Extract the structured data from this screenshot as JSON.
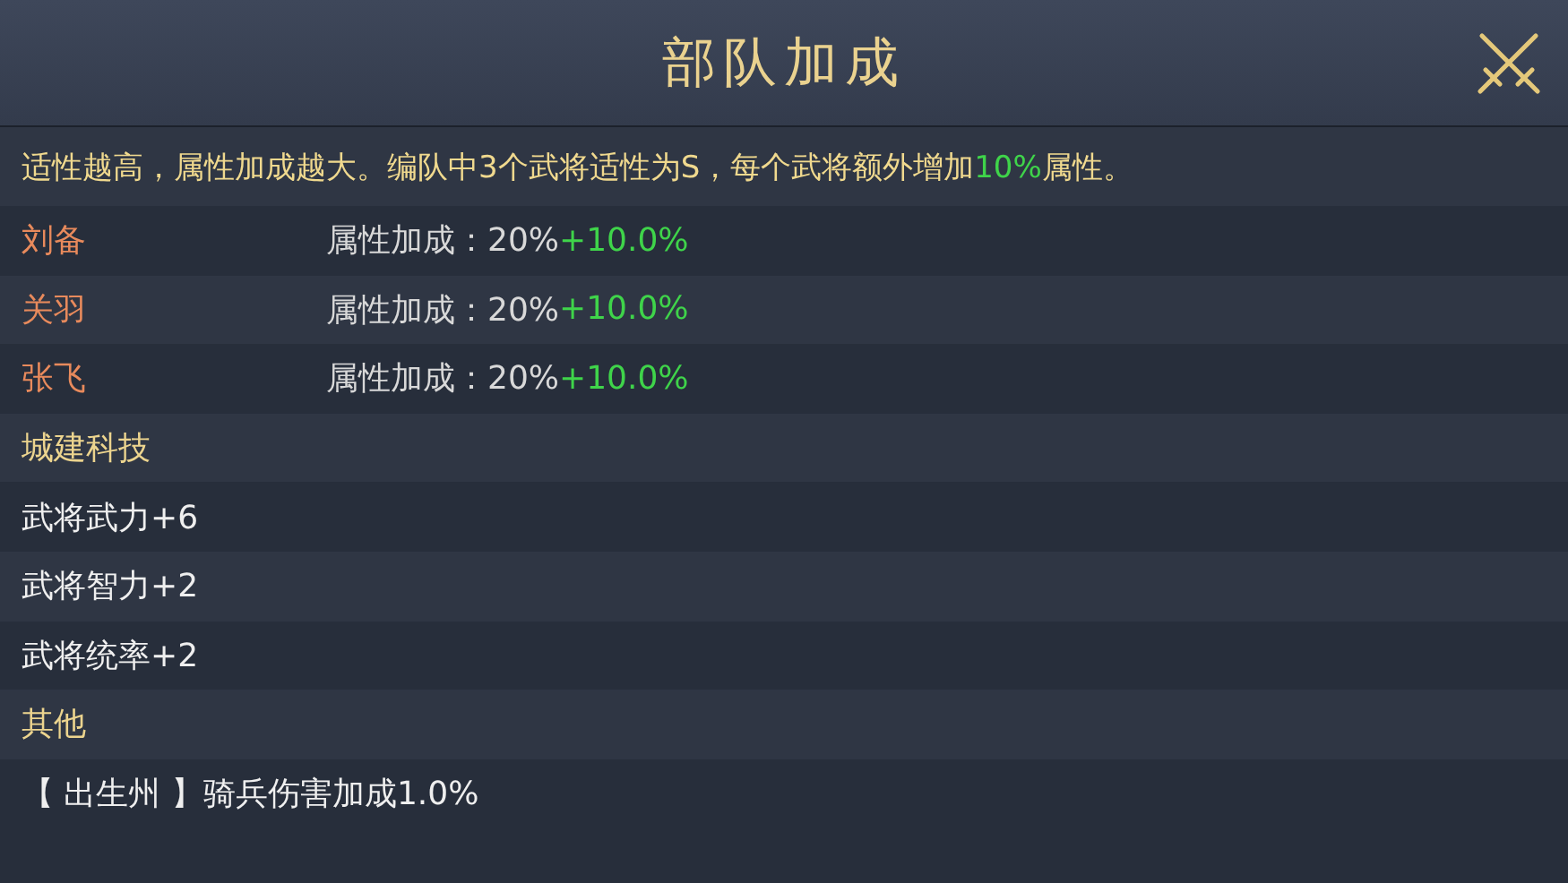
{
  "window": {
    "title": "部队加成"
  },
  "intro": [
    {
      "kind": "plain",
      "text": "适性越高，属性加成越大。编队中3个武将适性为S，每个武将额外增加"
    },
    {
      "kind": "highlight",
      "text": "10%"
    },
    {
      "kind": "plain",
      "text": "属性。"
    }
  ],
  "rows": [
    {
      "kind": "general",
      "name": "刘备",
      "label": "属性加成：20%",
      "bonus": "+10.0%"
    },
    {
      "kind": "general",
      "name": "关羽",
      "label": "属性加成：20%",
      "bonus": "+10.0%"
    },
    {
      "kind": "general",
      "name": "张飞",
      "label": "属性加成：20%",
      "bonus": "+10.0%"
    },
    {
      "kind": "header",
      "text": "城建科技"
    },
    {
      "kind": "item",
      "text": "武将武力+6"
    },
    {
      "kind": "item",
      "text": "武将智力+2"
    },
    {
      "kind": "item",
      "text": "武将统率+2"
    },
    {
      "kind": "header",
      "text": "其他"
    },
    {
      "kind": "item",
      "text": "【 出生州 】骑兵伤害加成1.0%"
    }
  ]
}
